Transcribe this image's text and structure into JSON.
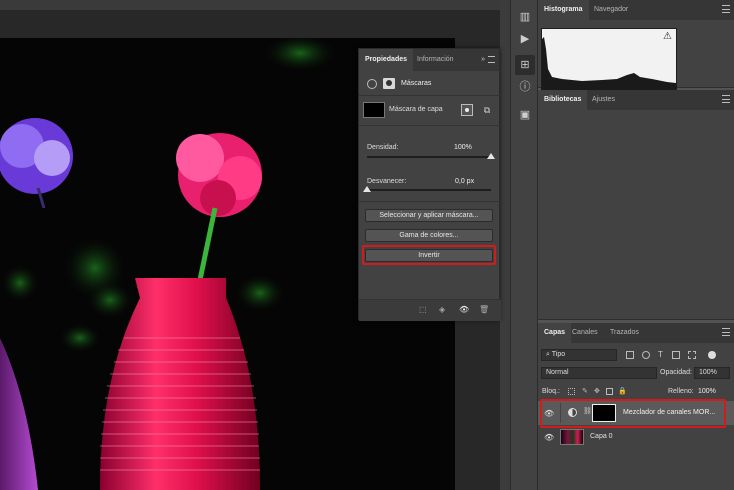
{
  "properties_panel": {
    "tabs": [
      "Propiedades",
      "Información"
    ],
    "section_label": "Máscaras",
    "mask_label": "Máscara de capa",
    "density_label": "Densidad:",
    "density_value": "100%",
    "density_level": 1.0,
    "feather_label": "Desvanecer:",
    "feather_value": "0,0 px",
    "feather_level": 0.0,
    "buttons": [
      "Seleccionar y aplicar máscara...",
      "Gama de colores...",
      "Invertir"
    ],
    "highlighted_button": "Invertir"
  },
  "histogram_panel": {
    "tabs": [
      "Histograma",
      "Navegador"
    ],
    "warning_icon": "warning-icon"
  },
  "libraries_panel": {
    "tabs": [
      "Bibliotecas",
      "Ajustes"
    ]
  },
  "layers_panel": {
    "tabs": [
      "Capas",
      "Canales",
      "Trazados"
    ],
    "filter_type": "Tipo",
    "blend_mode": "Normal",
    "opacity_label": "Opacidad:",
    "opacity_value": "100%",
    "lock_label": "Bloq.:",
    "fill_label": "Relleno:",
    "fill_value": "100%",
    "layers": [
      {
        "name": "Mezclador de canales MOR...",
        "type": "adjustment",
        "highlighted": true
      },
      {
        "name": "Capa 0",
        "type": "image",
        "highlighted": false
      }
    ]
  },
  "colors": {
    "highlight_outline": "#d21b1b",
    "panel_bg": "#424242",
    "tab_bar": "#363636"
  }
}
